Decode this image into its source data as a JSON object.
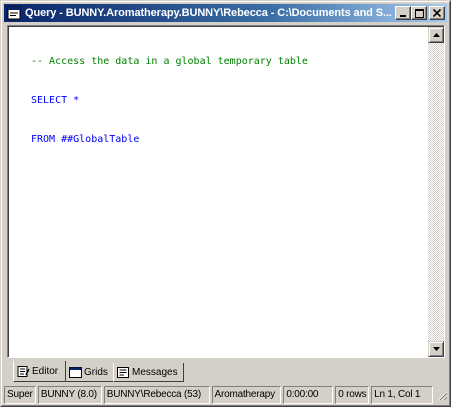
{
  "window": {
    "title": "Query - BUNNY.Aromatherapy.BUNNY\\Rebecca - C:\\Documents and S...",
    "minimize_label": "_",
    "maximize_label": "□",
    "close_label": "✕"
  },
  "editor": {
    "lines": [
      "-- Access the data in a global temporary table",
      "SELECT *",
      "FROM ##GlobalTable"
    ]
  },
  "tabs": [
    {
      "label": "Editor",
      "icon": "editor-icon",
      "active": true
    },
    {
      "label": "Grids",
      "icon": "grid-icon",
      "active": false
    },
    {
      "label": "Messages",
      "icon": "messages-icon",
      "active": false
    }
  ],
  "status": {
    "mode": "Super",
    "server": "BUNNY (8.0)",
    "user": "BUNNY\\Rebecca (53)",
    "database": "Aromatherapy",
    "elapsed": "0:00:00",
    "rows": "0 rows",
    "position": "Ln 1, Col 1"
  },
  "colors": {
    "titlebar_start": "#0a246a",
    "titlebar_end": "#a6caf0",
    "comment": "#008000",
    "keyword": "#0000ff"
  }
}
